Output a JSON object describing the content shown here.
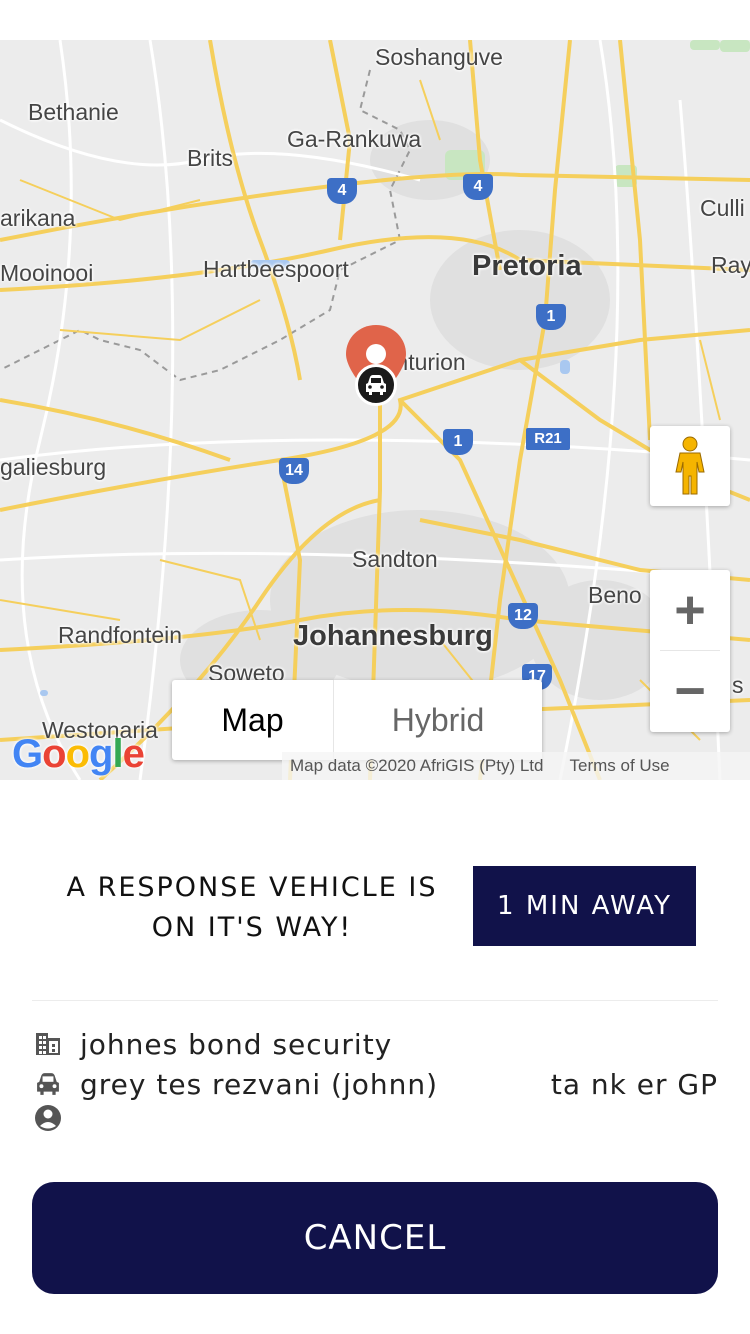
{
  "map": {
    "places": [
      {
        "name": "Soshanguve"
      },
      {
        "name": "Bethanie"
      },
      {
        "name": "Brits"
      },
      {
        "name": "Ga-Rankuwa"
      },
      {
        "name": "Culli"
      },
      {
        "name": "arikana"
      },
      {
        "name": "Mooinooi"
      },
      {
        "name": "Hartbeespoort"
      },
      {
        "name": "Pretoria"
      },
      {
        "name": "Ray"
      },
      {
        "name": "Centurion"
      },
      {
        "name": "galiesburg"
      },
      {
        "name": "Sandton"
      },
      {
        "name": "Beno"
      },
      {
        "name": "Randfontein"
      },
      {
        "name": "Johannesburg"
      },
      {
        "name": "Soweto"
      },
      {
        "name": "Westonaria"
      },
      {
        "name": "s"
      }
    ],
    "shields": [
      "4",
      "4",
      "1",
      "1",
      "R21",
      "14",
      "12",
      "17"
    ],
    "controls": {
      "zoom_in": "+",
      "zoom_out": "−",
      "type_map": "Map",
      "type_hybrid": "Hybrid"
    },
    "logo": "Google",
    "attribution": "Map data ©2020 AfriGIS (Pty) Ltd",
    "terms": "Terms of Use"
  },
  "status": {
    "message_line1": "A RESPONSE VEHICLE IS",
    "message_line2": "ON IT'S WAY!",
    "eta": "1 MIN AWAY"
  },
  "details": {
    "company": "johnes bond security",
    "vehicle": "grey tes rezvani (johnn)",
    "plate": "ta nk er GP",
    "driver": ""
  },
  "actions": {
    "cancel_label": "CANCEL"
  },
  "colors": {
    "primary": "#11124a",
    "pin": "#e0644a",
    "road": "#f5cf5c",
    "shield": "#3d6fc6"
  },
  "icons": [
    "pegman-icon",
    "building-icon",
    "car-icon",
    "person-icon",
    "location-pin-icon"
  ]
}
